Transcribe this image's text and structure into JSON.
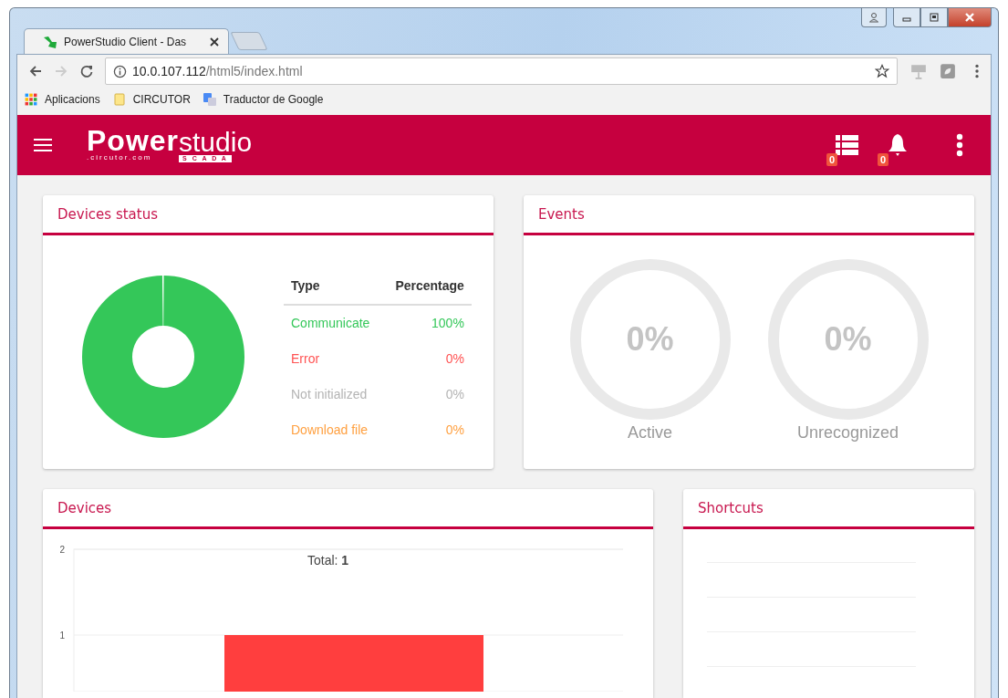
{
  "browser": {
    "tab_title": "PowerStudio Client - Das",
    "url_host": "10.0.107.112",
    "url_path": "/html5/index.html",
    "bookmarks": [
      {
        "label": "Aplicacions",
        "kind": "apps"
      },
      {
        "label": "CIRCUTOR",
        "kind": "folder"
      },
      {
        "label": "Traductor de Google",
        "kind": "translate"
      }
    ]
  },
  "header": {
    "logo": {
      "word": "Power",
      "sub": ".circutor.com",
      "product": "studio",
      "edition": "S C A D A"
    },
    "badges": [
      {
        "kind": "list",
        "count": "0"
      },
      {
        "kind": "bell",
        "count": "0"
      }
    ]
  },
  "devices_status": {
    "title": "Devices status",
    "columns": [
      "Type",
      "Percentage"
    ],
    "rows": [
      {
        "percentage": "100%",
        "color": "#34c759"
      },
      {
        "percentage": "0%",
        "color": "#ff5252"
      },
      {
        "percentage": "0%",
        "color": "#b4b4b4"
      },
      {
        "percentage": "0%",
        "color": "#ffa040"
      }
    ],
    "chart_data": {
      "type": "pie",
      "categories": [
        "Communicate",
        "Error",
        "Not initialized",
        "Download file"
      ],
      "values": [
        100,
        0,
        0,
        0
      ]
    }
  },
  "events": {
    "title": "Events",
    "gauges": [
      {
        "value": "0%",
        "label": "Active",
        "level": 0
      },
      {
        "value": "0%",
        "label": "Unrecognized",
        "level": 0
      }
    ]
  },
  "devices": {
    "title": "Devices",
    "chart_title": "Total: **1**",
    "axis_labels": [
      "2",
      "1"
    ]
  },
  "shortcuts": {
    "title": "Shortcuts"
  }
}
